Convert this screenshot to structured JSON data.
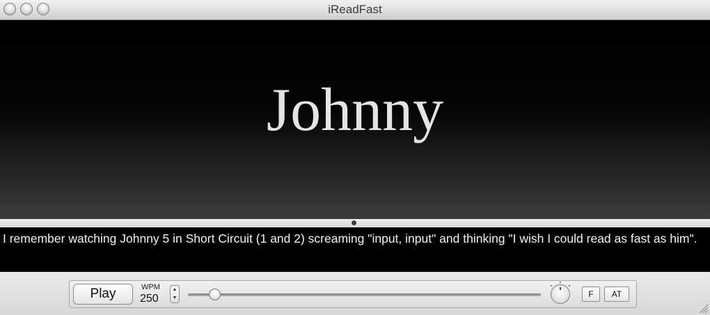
{
  "window": {
    "title": "iReadFast"
  },
  "display": {
    "current_word": "Johnny"
  },
  "source_text": {
    "content": "I remember watching Johnny 5 in Short Circuit (1 and 2) screaming \"input, input\" and thinking \"I wish I could read as fast as him\"."
  },
  "controls": {
    "play_label": "Play",
    "wpm_label": "WPM",
    "wpm_value": "250",
    "stepper_up": "▲",
    "stepper_down": "▼",
    "speed_slider_fraction": 0.075,
    "f_label": "F",
    "at_label": "AT"
  },
  "icons": {
    "window_controls": [
      "close-icon",
      "minimize-icon",
      "zoom-icon"
    ],
    "stepper": "stepper-icon",
    "dial": "dial-icon",
    "resize": "resize-grip-icon"
  }
}
